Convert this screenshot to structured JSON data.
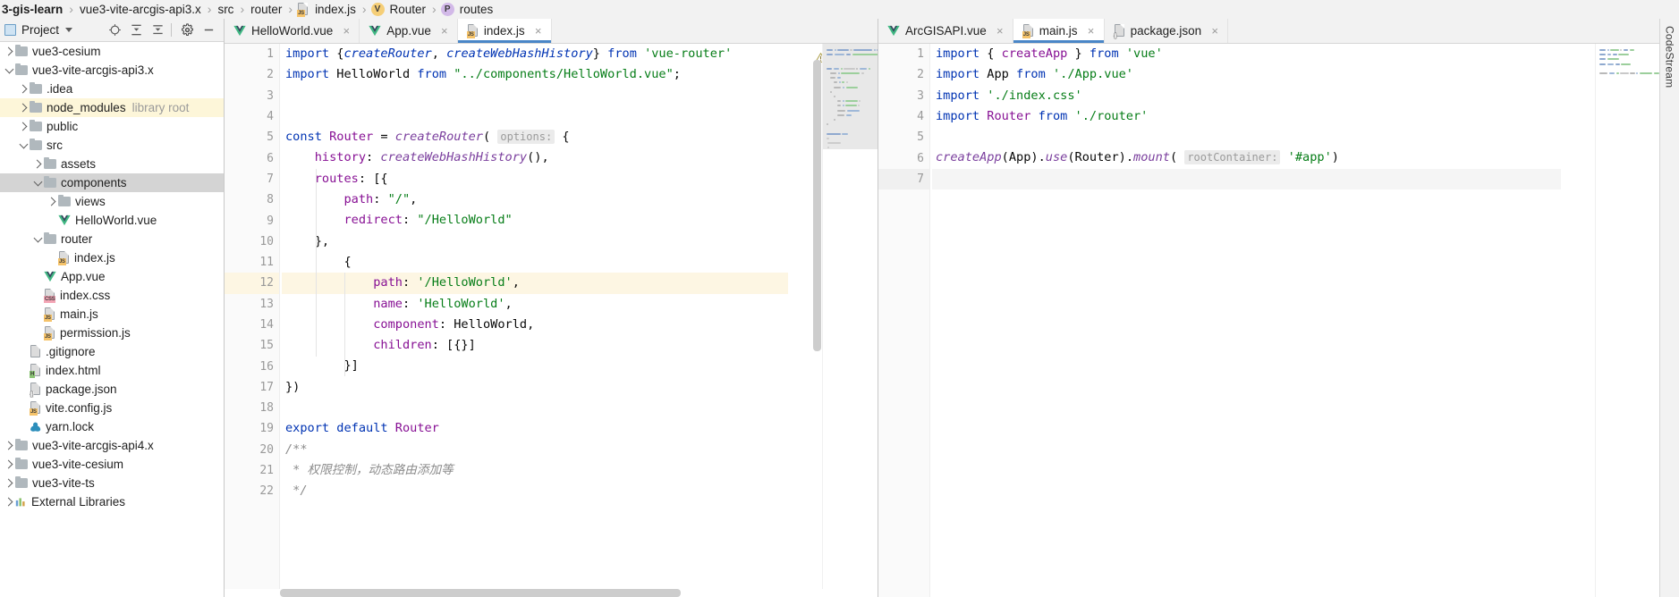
{
  "breadcrumb": {
    "items": [
      {
        "label": "3-gis-learn",
        "icon": "none",
        "bold": true
      },
      {
        "label": "vue3-vite-arcgis-api3.x",
        "icon": "none"
      },
      {
        "label": "src",
        "icon": "none"
      },
      {
        "label": "router",
        "icon": "none"
      },
      {
        "label": "index.js",
        "icon": "js-file-icon"
      },
      {
        "label": "Router",
        "icon": "variable-badge-v"
      },
      {
        "label": "routes",
        "icon": "property-badge-p"
      }
    ]
  },
  "project_panel": {
    "title": "Project",
    "toolbar_buttons": [
      {
        "name": "select-opened-file-button",
        "icon": "crosshair-icon"
      },
      {
        "name": "expand-all-button",
        "icon": "expand-all-icon"
      },
      {
        "name": "collapse-all-button",
        "icon": "collapse-all-icon"
      },
      {
        "name": "settings-button",
        "icon": "gear-icon"
      },
      {
        "name": "hide-button",
        "icon": "minimize-icon"
      }
    ],
    "tree": [
      {
        "label": "vue3-cesium",
        "type": "folder",
        "indent": 0,
        "arrow": "right"
      },
      {
        "label": "vue3-vite-arcgis-api3.x",
        "type": "folder",
        "indent": 0,
        "arrow": "down"
      },
      {
        "label": ".idea",
        "type": "folder",
        "indent": 1,
        "arrow": "right"
      },
      {
        "label": "node_modules",
        "type": "folder",
        "indent": 1,
        "arrow": "right",
        "note": "library root",
        "state": "library"
      },
      {
        "label": "public",
        "type": "folder",
        "indent": 1,
        "arrow": "right"
      },
      {
        "label": "src",
        "type": "folder",
        "indent": 1,
        "arrow": "down"
      },
      {
        "label": "assets",
        "type": "folder",
        "indent": 2,
        "arrow": "right"
      },
      {
        "label": "components",
        "type": "folder",
        "indent": 2,
        "arrow": "down",
        "state": "selected"
      },
      {
        "label": "views",
        "type": "folder",
        "indent": 3,
        "arrow": "right"
      },
      {
        "label": "HelloWorld.vue",
        "type": "vue",
        "indent": 3,
        "arrow": "none"
      },
      {
        "label": "router",
        "type": "folder",
        "indent": 2,
        "arrow": "down"
      },
      {
        "label": "index.js",
        "type": "js",
        "indent": 3,
        "arrow": "none"
      },
      {
        "label": "App.vue",
        "type": "vue",
        "indent": 2,
        "arrow": "none"
      },
      {
        "label": "index.css",
        "type": "css",
        "indent": 2,
        "arrow": "none"
      },
      {
        "label": "main.js",
        "type": "js",
        "indent": 2,
        "arrow": "none"
      },
      {
        "label": "permission.js",
        "type": "js",
        "indent": 2,
        "arrow": "none"
      },
      {
        "label": ".gitignore",
        "type": "git",
        "indent": 1,
        "arrow": "none"
      },
      {
        "label": "index.html",
        "type": "html",
        "indent": 1,
        "arrow": "none"
      },
      {
        "label": "package.json",
        "type": "json",
        "indent": 1,
        "arrow": "none"
      },
      {
        "label": "vite.config.js",
        "type": "js",
        "indent": 1,
        "arrow": "none"
      },
      {
        "label": "yarn.lock",
        "type": "yarn",
        "indent": 1,
        "arrow": "none"
      },
      {
        "label": "vue3-vite-arcgis-api4.x",
        "type": "folder",
        "indent": 0,
        "arrow": "right"
      },
      {
        "label": "vue3-vite-cesium",
        "type": "folder",
        "indent": 0,
        "arrow": "right"
      },
      {
        "label": "vue3-vite-ts",
        "type": "folder",
        "indent": 0,
        "arrow": "right"
      },
      {
        "label": "External Libraries",
        "type": "lib",
        "indent": 0,
        "arrow": "right"
      }
    ]
  },
  "left_editor": {
    "tabs": [
      {
        "label": "HelloWorld.vue",
        "icon": "vue-file-icon",
        "active": false
      },
      {
        "label": "App.vue",
        "icon": "vue-file-icon",
        "active": false
      },
      {
        "label": "index.js",
        "icon": "js-file-icon",
        "active": true
      }
    ],
    "close_label": "×",
    "inspection": {
      "warning_count": "1",
      "warning_icon": "warning-triangle-icon",
      "prev_icon": "⌃",
      "next_icon": "⌄"
    },
    "first_line": 1,
    "lines": [
      {
        "n": "1",
        "fold": "top",
        "tokens": [
          {
            "t": "import ",
            "c": "kw"
          },
          {
            "t": "{",
            "c": "plain"
          },
          {
            "t": "createRouter",
            "c": "kw2"
          },
          {
            "t": ", ",
            "c": "plain"
          },
          {
            "t": "createWebHashHistory",
            "c": "kw2"
          },
          {
            "t": "} ",
            "c": "plain"
          },
          {
            "t": "from ",
            "c": "kw"
          },
          {
            "t": "'vue-router'",
            "c": "str"
          }
        ]
      },
      {
        "n": "2",
        "fold": "bot",
        "tokens": [
          {
            "t": "import ",
            "c": "kw"
          },
          {
            "t": "HelloWorld ",
            "c": "plain"
          },
          {
            "t": "from ",
            "c": "kw"
          },
          {
            "t": "\"../components/HelloWorld.vue\"",
            "c": "str"
          },
          {
            "t": ";",
            "c": "plain"
          }
        ]
      },
      {
        "n": "3",
        "fold": "",
        "tokens": []
      },
      {
        "n": "4",
        "fold": "",
        "tokens": []
      },
      {
        "n": "5",
        "fold": "top",
        "tokens": [
          {
            "t": "const ",
            "c": "kw"
          },
          {
            "t": "Router",
            "c": "id"
          },
          {
            "t": " = ",
            "c": "plain"
          },
          {
            "t": "createRouter",
            "c": "fn"
          },
          {
            "t": "( ",
            "c": "plain"
          },
          {
            "t": "options:",
            "c": "hintp"
          },
          {
            "t": " {",
            "c": "plain"
          }
        ]
      },
      {
        "n": "6",
        "fold": "",
        "tokens": [
          {
            "t": "    history",
            "c": "prop"
          },
          {
            "t": ": ",
            "c": "plain"
          },
          {
            "t": "createWebHashHistory",
            "c": "fn"
          },
          {
            "t": "(),",
            "c": "plain"
          }
        ]
      },
      {
        "n": "7",
        "fold": "top",
        "tokens": [
          {
            "t": "    routes",
            "c": "prop"
          },
          {
            "t": ": [{",
            "c": "plain"
          }
        ]
      },
      {
        "n": "8",
        "fold": "",
        "tokens": [
          {
            "t": "        path",
            "c": "prop"
          },
          {
            "t": ": ",
            "c": "plain"
          },
          {
            "t": "\"/\"",
            "c": "str"
          },
          {
            "t": ",",
            "c": "plain"
          }
        ]
      },
      {
        "n": "9",
        "fold": "",
        "tokens": [
          {
            "t": "        redirect",
            "c": "prop"
          },
          {
            "t": ": ",
            "c": "plain"
          },
          {
            "t": "\"/HelloWorld\"",
            "c": "str"
          }
        ]
      },
      {
        "n": "10",
        "fold": "bot",
        "tokens": [
          {
            "t": "    },",
            "c": "plain"
          }
        ]
      },
      {
        "n": "11",
        "fold": "top",
        "tokens": [
          {
            "t": "        {",
            "c": "plain"
          }
        ]
      },
      {
        "n": "12",
        "fold": "",
        "highlight": true,
        "bulb": true,
        "tokens": [
          {
            "t": "            path",
            "c": "prop"
          },
          {
            "t": ": ",
            "c": "plain"
          },
          {
            "t": "'/HelloWorld'",
            "c": "str"
          },
          {
            "t": ",",
            "c": "plain"
          }
        ]
      },
      {
        "n": "13",
        "fold": "",
        "tokens": [
          {
            "t": "            name",
            "c": "prop"
          },
          {
            "t": ": ",
            "c": "plain"
          },
          {
            "t": "'HelloWorld'",
            "c": "str"
          },
          {
            "t": ",",
            "c": "plain"
          }
        ]
      },
      {
        "n": "14",
        "fold": "",
        "tokens": [
          {
            "t": "            component",
            "c": "prop"
          },
          {
            "t": ": HelloWorld,",
            "c": "plain"
          }
        ]
      },
      {
        "n": "15",
        "fold": "",
        "tokens": [
          {
            "t": "            children",
            "c": "prop"
          },
          {
            "t": ": [{}]",
            "c": "plain"
          }
        ]
      },
      {
        "n": "16",
        "fold": "bot",
        "tokens": [
          {
            "t": "        }]",
            "c": "plain"
          }
        ]
      },
      {
        "n": "17",
        "fold": "bot",
        "tokens": [
          {
            "t": "})",
            "c": "plain"
          }
        ]
      },
      {
        "n": "18",
        "fold": "",
        "tokens": []
      },
      {
        "n": "19",
        "fold": "",
        "tokens": [
          {
            "t": "export default ",
            "c": "kw"
          },
          {
            "t": "Router",
            "c": "id"
          }
        ]
      },
      {
        "n": "20",
        "fold": "top",
        "tokens": [
          {
            "t": "/**",
            "c": "cmt"
          }
        ]
      },
      {
        "n": "21",
        "fold": "",
        "tokens": [
          {
            "t": " * 权限控制，动态路由添加等",
            "c": "cmt"
          }
        ]
      },
      {
        "n": "22",
        "fold": "bot",
        "tokens": [
          {
            "t": " */",
            "c": "cmt"
          }
        ]
      }
    ]
  },
  "right_editor": {
    "tabs": [
      {
        "label": "ArcGISAPI.vue",
        "icon": "vue-file-icon",
        "active": false
      },
      {
        "label": "main.js",
        "icon": "js-file-icon",
        "active": true
      },
      {
        "label": "package.json",
        "icon": "json-file-icon",
        "active": false
      }
    ],
    "close_label": "×",
    "status_icon": "checkmark-ok-icon",
    "lines": [
      {
        "n": "1",
        "fold": "top",
        "tokens": [
          {
            "t": "import ",
            "c": "kw"
          },
          {
            "t": "{ ",
            "c": "plain"
          },
          {
            "t": "createApp",
            "c": "id"
          },
          {
            "t": " } ",
            "c": "plain"
          },
          {
            "t": "from ",
            "c": "kw"
          },
          {
            "t": "'vue'",
            "c": "str"
          }
        ]
      },
      {
        "n": "2",
        "fold": "",
        "tokens": [
          {
            "t": "import ",
            "c": "kw"
          },
          {
            "t": "App ",
            "c": "plain"
          },
          {
            "t": "from ",
            "c": "kw"
          },
          {
            "t": "'./App.vue'",
            "c": "str"
          }
        ]
      },
      {
        "n": "3",
        "fold": "",
        "tokens": [
          {
            "t": "import ",
            "c": "kw"
          },
          {
            "t": "'./index.css'",
            "c": "str"
          }
        ]
      },
      {
        "n": "4",
        "fold": "bot",
        "tokens": [
          {
            "t": "import ",
            "c": "kw"
          },
          {
            "t": "Router ",
            "c": "id"
          },
          {
            "t": "from ",
            "c": "kw"
          },
          {
            "t": "'./router'",
            "c": "str"
          }
        ]
      },
      {
        "n": "5",
        "fold": "",
        "tokens": []
      },
      {
        "n": "6",
        "fold": "",
        "tokens": [
          {
            "t": "createApp",
            "c": "fn"
          },
          {
            "t": "(App).",
            "c": "plain"
          },
          {
            "t": "use",
            "c": "fn"
          },
          {
            "t": "(Router).",
            "c": "plain"
          },
          {
            "t": "mount",
            "c": "fn"
          },
          {
            "t": "( ",
            "c": "plain"
          },
          {
            "t": "rootContainer:",
            "c": "hintp"
          },
          {
            "t": " ",
            "c": "plain"
          },
          {
            "t": "'#app'",
            "c": "str"
          },
          {
            "t": ")",
            "c": "plain"
          }
        ]
      },
      {
        "n": "7",
        "fold": "",
        "cursor": true,
        "tokens": []
      }
    ]
  },
  "right_strip": {
    "label": "CodeStream"
  },
  "colors": {
    "accent": "#4a86c7",
    "keyword": "#0033b3",
    "string": "#067d17",
    "identifier": "#871094",
    "comment": "#8c8c8c",
    "selection": "#d4d4d4",
    "library_root": "#fdf6d9",
    "highlight_line": "#fdf6e3",
    "ok_green": "#59a869",
    "warning": "#8a7a3a"
  }
}
